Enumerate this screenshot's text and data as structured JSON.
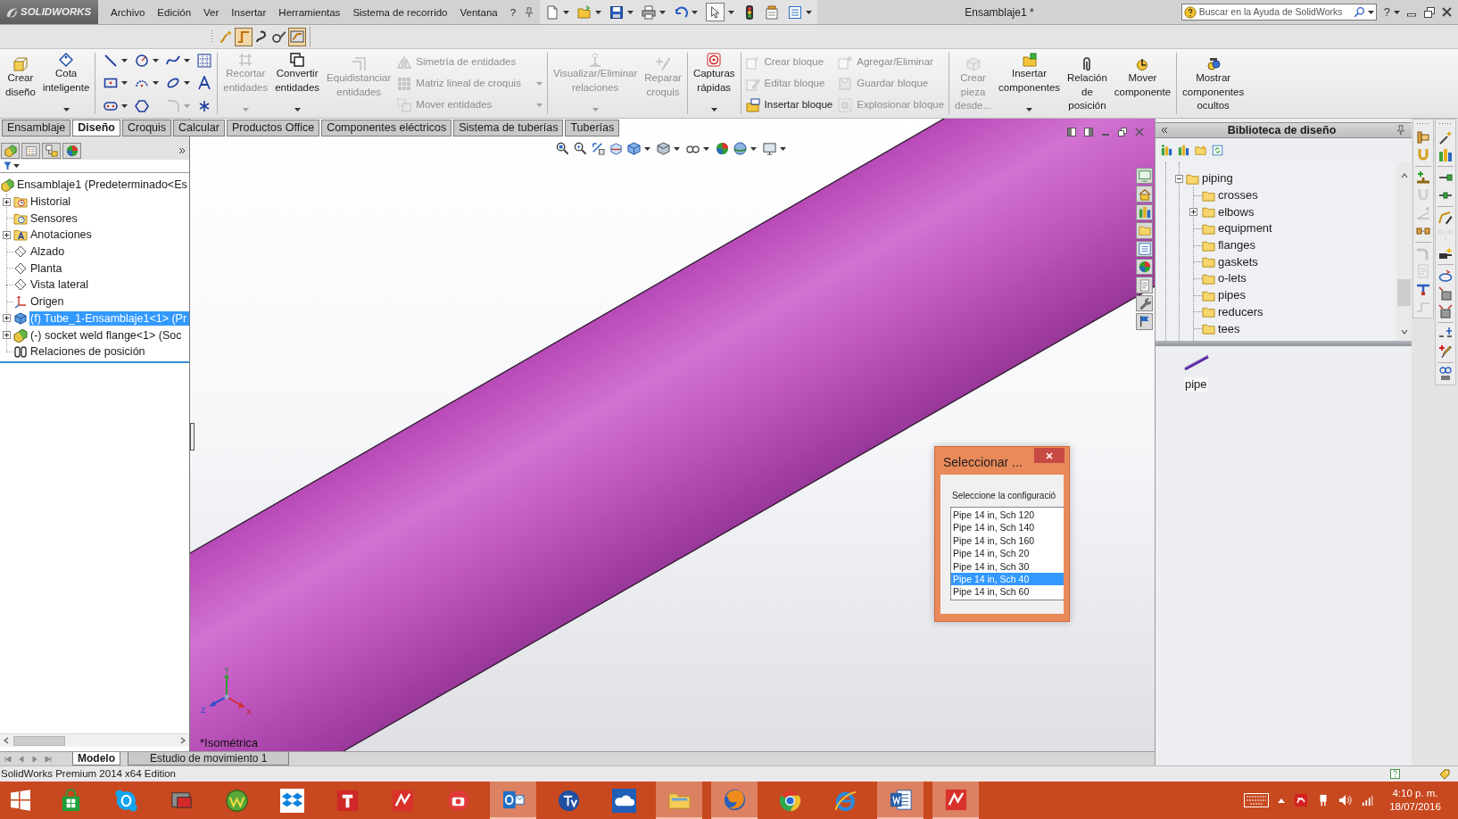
{
  "menu_bar": {
    "app_name": "SOLIDWORKS",
    "menus": [
      "Archivo",
      "Edición",
      "Ver",
      "Insertar",
      "Herramientas",
      "Sistema de recorrido",
      "Ventana",
      "?"
    ],
    "select_tool": {
      "selected": true
    },
    "document_title": "Ensamblaje1 *",
    "search": {
      "placeholder": "Buscar en la Ayuda de SolidWorks"
    },
    "help": "?"
  },
  "routing_toolbar": [
    {
      "selected": false
    },
    {
      "selected": true
    },
    {
      "selected": false
    },
    {
      "selected": false
    },
    {
      "selected": true
    }
  ],
  "command_manager": [
    {
      "kind": "large",
      "label": "Crear\ndiseño",
      "disabled": false,
      "dropdown": false
    },
    {
      "kind": "large",
      "label": "Cota\ninteligente",
      "disabled": false,
      "dropdown": true
    },
    {
      "kind": "separator"
    },
    {
      "kind": "sketch_tools",
      "tools": [
        {
          "dropdown": true,
          "disabled": false
        },
        {
          "dropdown": true,
          "disabled": false
        },
        {
          "dropdown": true,
          "disabled": false
        },
        {
          "dropdown": false,
          "disabled": false
        },
        {
          "dropdown": true,
          "disabled": false
        },
        {
          "dropdown": true,
          "disabled": false
        },
        {
          "dropdown": true,
          "disabled": false
        },
        {
          "dropdown": false,
          "disabled": false
        },
        {
          "dropdown": true,
          "disabled": false
        },
        {
          "dropdown": false,
          "disabled": false
        },
        {
          "dropdown": true,
          "disabled": true
        },
        {
          "dropdown": false,
          "disabled": false
        }
      ]
    },
    {
      "kind": "separator"
    },
    {
      "kind": "large",
      "label": "Recortar\nentidades",
      "disabled": true,
      "dropdown": true
    },
    {
      "kind": "large",
      "label": "Convertir\nentidades",
      "disabled": false,
      "dropdown": true
    },
    {
      "kind": "large",
      "label": "Equidistanciar\nentidades",
      "disabled": true,
      "dropdown": false
    },
    {
      "kind": "stack",
      "items": [
        {
          "label": "Simetría de entidades",
          "disabled": true,
          "dropdown": false
        },
        {
          "label": "Matriz lineal de croquis",
          "disabled": true,
          "dropdown": true
        },
        {
          "label": "Mover entidades",
          "disabled": true,
          "dropdown": true
        }
      ]
    },
    {
      "kind": "separator"
    },
    {
      "kind": "large",
      "label": "Visualizar/Eliminar\nrelaciones",
      "disabled": true,
      "dropdown": true
    },
    {
      "kind": "large",
      "label": "Reparar\ncroquis",
      "disabled": true,
      "dropdown": false
    },
    {
      "kind": "separator"
    },
    {
      "kind": "large",
      "label": "Capturas\nrápidas",
      "disabled": false,
      "dropdown": true
    },
    {
      "kind": "separator"
    },
    {
      "kind": "stack",
      "items": [
        {
          "label": "Crear bloque",
          "disabled": true,
          "dropdown": false
        },
        {
          "label": "Editar bloque",
          "disabled": true,
          "dropdown": false
        },
        {
          "label": "Insertar bloque",
          "disabled": false,
          "dropdown": false
        }
      ]
    },
    {
      "kind": "stack",
      "items": [
        {
          "label": "Agregar/Eliminar",
          "disabled": true,
          "dropdown": false
        },
        {
          "label": "Guardar bloque",
          "disabled": true,
          "dropdown": false
        },
        {
          "label": "Explosionar bloque",
          "disabled": true,
          "dropdown": false
        }
      ]
    },
    {
      "kind": "separator"
    },
    {
      "kind": "large",
      "label": "Crear\npieza\ndesde...",
      "disabled": true,
      "dropdown": false
    },
    {
      "kind": "large",
      "label": "Insertar\ncomponentes",
      "disabled": false,
      "dropdown": true
    },
    {
      "kind": "large",
      "label": "Relación\nde\nposición",
      "disabled": false,
      "dropdown": false
    },
    {
      "kind": "large",
      "label": "Mover\ncomponente",
      "disabled": false,
      "dropdown": false
    },
    {
      "kind": "separator"
    },
    {
      "kind": "large",
      "label": "Mostrar\ncomponentes\nocultos",
      "disabled": false,
      "dropdown": false
    }
  ],
  "tabs": [
    {
      "label": "Ensamblaje",
      "selected": false
    },
    {
      "label": "Diseño",
      "selected": true
    },
    {
      "label": "Croquis",
      "selected": false
    },
    {
      "label": "Calcular",
      "selected": false
    },
    {
      "label": "Productos Office",
      "selected": false
    },
    {
      "label": "Componentes eléctricos",
      "selected": false
    },
    {
      "label": "Sistema de tuberías",
      "selected": false
    },
    {
      "label": "Tuberías",
      "selected": false
    }
  ],
  "feature_tree": {
    "label": "Ensamblaje1 (Predeterminado<Es",
    "selected": false,
    "children": [
      {
        "kind": "history",
        "label": "Historial",
        "expandable": true,
        "selected": false
      },
      {
        "kind": "sensors",
        "label": "Sensores",
        "expandable": false,
        "selected": false
      },
      {
        "kind": "annotations",
        "label": "Anotaciones",
        "expandable": true,
        "selected": false
      },
      {
        "kind": "plane",
        "label": "Alzado",
        "expandable": false,
        "selected": false
      },
      {
        "kind": "plane",
        "label": "Planta",
        "expandable": false,
        "selected": false
      },
      {
        "kind": "plane",
        "label": "Vista lateral",
        "expandable": false,
        "selected": false
      },
      {
        "kind": "origin",
        "label": "Origen",
        "expandable": false,
        "selected": false
      },
      {
        "kind": "part",
        "label": "(f) Tube_1-Ensamblaje1<1> (Pr",
        "expandable": true,
        "selected": true
      },
      {
        "kind": "subassembly",
        "label": "(-) socket weld flange<1> (Soc",
        "expandable": true,
        "selected": false
      },
      {
        "kind": "mates",
        "label": "Relaciones de posición",
        "expandable": false,
        "selected": false
      }
    ]
  },
  "viewport": {
    "view_name": "*Isométrica",
    "triad": [
      "Y",
      "Z",
      "X"
    ]
  },
  "dialog": {
    "title": "Seleccionar ...",
    "prompt": "Seleccione la configuració",
    "options": [
      {
        "label": "Pipe 14 in, Sch 120",
        "selected": false
      },
      {
        "label": "Pipe 14 in, Sch 140",
        "selected": false
      },
      {
        "label": "Pipe 14 in, Sch 160",
        "selected": false
      },
      {
        "label": "Pipe 14 in, Sch 20",
        "selected": false
      },
      {
        "label": "Pipe 14 in, Sch 30",
        "selected": false
      },
      {
        "label": "Pipe 14 in, Sch 40",
        "selected": true
      },
      {
        "label": "Pipe 14 in, Sch 60",
        "selected": false
      }
    ]
  },
  "design_library": {
    "title": "Biblioteca de diseño",
    "tree": {
      "label": "piping",
      "expanded": true,
      "children": [
        {
          "label": "crosses",
          "expandable": false
        },
        {
          "label": "elbows",
          "expandable": true
        },
        {
          "label": "equipment",
          "expandable": false
        },
        {
          "label": "flanges",
          "expandable": false
        },
        {
          "label": "gaskets",
          "expandable": false
        },
        {
          "label": "o-lets",
          "expandable": false
        },
        {
          "label": "pipes",
          "expandable": false
        },
        {
          "label": "reducers",
          "expandable": false
        },
        {
          "label": "tees",
          "expandable": false
        }
      ]
    },
    "contents": [
      {
        "label": "pipe"
      }
    ]
  },
  "side_toolbars": [
    {
      "groups": [
        [
          {
            "disabled": false
          },
          {
            "disabled": false
          }
        ],
        [
          {
            "disabled": false
          },
          {
            "disabled": true
          },
          {
            "disabled": true
          },
          {
            "disabled": false
          }
        ],
        [
          {
            "disabled": true
          },
          {
            "disabled": true
          },
          {
            "disabled": false
          },
          {
            "disabled": true
          }
        ]
      ]
    },
    {
      "groups": [
        [
          {
            "disabled": false
          },
          {
            "disabled": false
          }
        ],
        [
          {
            "disabled": false
          },
          {
            "disabled": false
          }
        ],
        [
          {
            "disabled": false
          },
          {
            "disabled": true
          },
          {
            "disabled": false
          }
        ],
        [
          {
            "disabled": false
          },
          {
            "disabled": false
          },
          {
            "disabled": false
          }
        ],
        [
          {
            "disabled": false
          },
          {
            "disabled": false
          }
        ],
        [
          {
            "disabled": false
          }
        ]
      ]
    }
  ],
  "bottom_tabs": [
    {
      "label": "Modelo",
      "selected": true
    },
    {
      "label": "Estudio de movimiento 1",
      "selected": false
    }
  ],
  "status_bar": {
    "text": "SolidWorks Premium 2014 x64 Edition"
  },
  "taskbar": {
    "apps": [
      {
        "running": false
      },
      {
        "running": false
      },
      {
        "running": false
      },
      {
        "running": false
      },
      {
        "running": false
      },
      {
        "running": false
      },
      {
        "running": false
      },
      {
        "running": false
      },
      {
        "running": true
      },
      {
        "running": false
      },
      {
        "running": false
      },
      {
        "running": true
      },
      {
        "running": true
      },
      {
        "running": false
      },
      {
        "running": false
      },
      {
        "running": true
      },
      {
        "running": true
      }
    ],
    "time": "4:10 p. m.",
    "date": "18/07/2016"
  }
}
